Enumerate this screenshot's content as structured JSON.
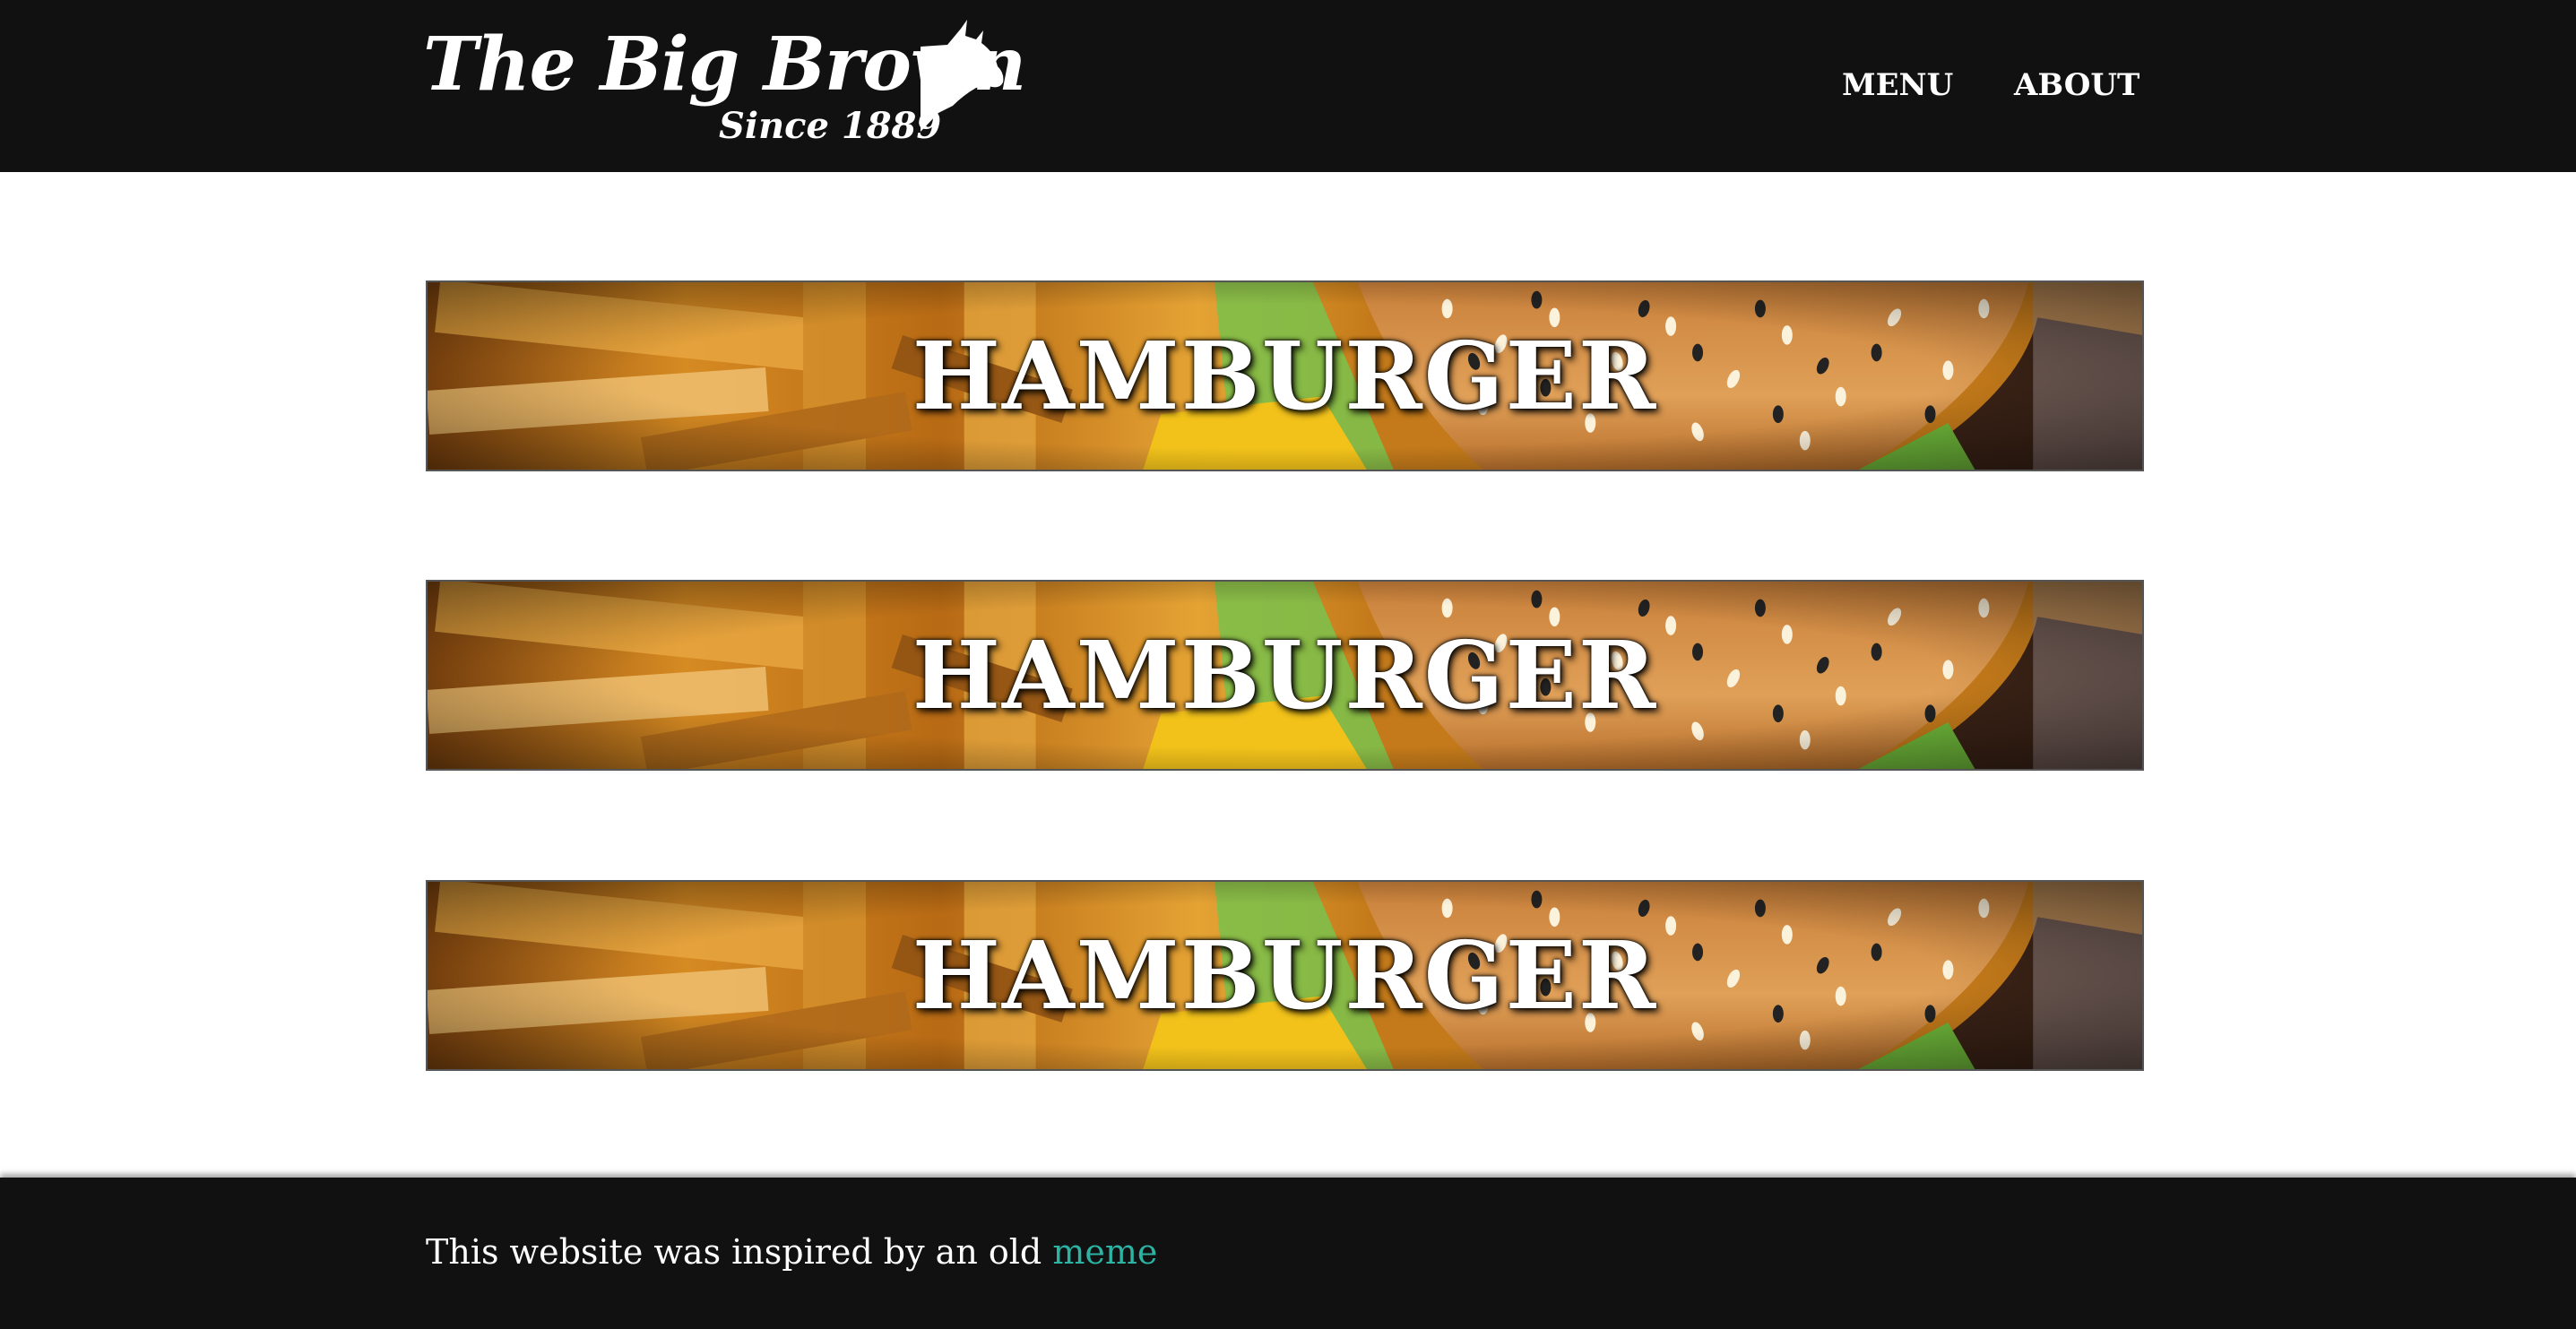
{
  "header": {
    "logo_title": "The Big Brown",
    "logo_subtitle": "Since 1889",
    "logo_icon": "cow-head-icon",
    "nav": {
      "menu_label": "MENU",
      "about_label": "ABOUT"
    }
  },
  "banners": [
    {
      "title": "HAMBURGER",
      "image": "burger-and-fries-photo"
    },
    {
      "title": "HAMBURGER",
      "image": "burger-and-fries-photo"
    },
    {
      "title": "HAMBURGER",
      "image": "burger-and-fries-photo"
    }
  ],
  "footer": {
    "text": "This website was inspired by an old ",
    "link_label": "meme"
  },
  "colors": {
    "header_bg": "#111111",
    "footer_bg": "#111111",
    "link_accent": "#2bb3a3",
    "text_light": "#ffffff"
  }
}
